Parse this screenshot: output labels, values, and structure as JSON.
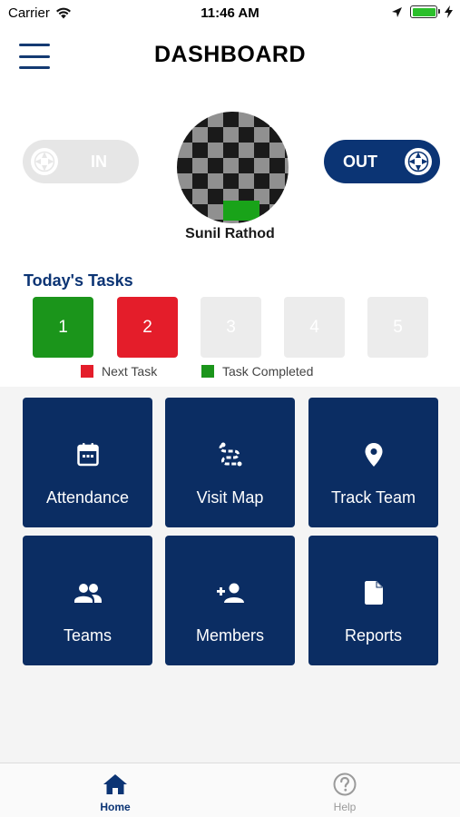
{
  "statusbar": {
    "carrier": "Carrier",
    "time": "11:46 AM",
    "battery_level": 1.0
  },
  "header": {
    "title": "DASHBOARD"
  },
  "attendance": {
    "in_label": "IN",
    "out_label": "OUT"
  },
  "profile": {
    "name": "Sunil Rathod"
  },
  "tasks": {
    "title": "Today's Tasks",
    "items": [
      {
        "label": "1",
        "status": "completed"
      },
      {
        "label": "2",
        "status": "next"
      },
      {
        "label": "3",
        "status": "pending"
      },
      {
        "label": "4",
        "status": "pending"
      },
      {
        "label": "5",
        "status": "pending"
      }
    ],
    "legend": {
      "next": "Next Task",
      "completed": "Task Completed"
    }
  },
  "tiles": [
    {
      "label": "Attendance",
      "icon": "calendar-icon"
    },
    {
      "label": "Visit Map",
      "icon": "route-icon"
    },
    {
      "label": "Track Team",
      "icon": "location-pin-icon"
    },
    {
      "label": "Teams",
      "icon": "group-icon"
    },
    {
      "label": "Members",
      "icon": "add-person-icon"
    },
    {
      "label": "Reports",
      "icon": "document-icon"
    }
  ],
  "tabbar": {
    "home_label": "Home",
    "help_label": "Help"
  },
  "colors": {
    "primary": "#0b3474",
    "tile": "#0b2d63",
    "completed": "#1b951b",
    "next": "#e41d2a",
    "pending": "#ececec"
  }
}
